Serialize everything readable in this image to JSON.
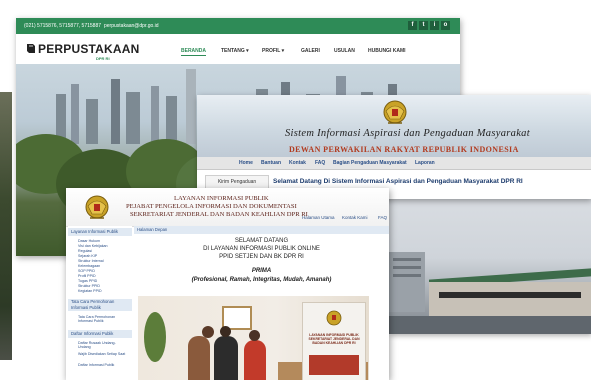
{
  "library": {
    "phone": "(021) 5715876, 5715877, 5715887",
    "email": "perpustakaan@dpr.go.id",
    "logo": "PERPUSTAKAAN",
    "logo_sub": "DPR RI",
    "nav": [
      "BERANDA",
      "TENTANG ▾",
      "PROFIL ▾",
      "GALERI",
      "USULAN",
      "HUBUNGI KAMI"
    ],
    "social": [
      "f",
      "t",
      "i",
      "o"
    ]
  },
  "aspirasi": {
    "title": "Sistem Informasi Aspirasi dan Pengaduan Masyarakat",
    "org": "DEWAN PERWAKILAN RAKYAT REPUBLIK INDONESIA",
    "nav": [
      "Home",
      "Bantuan",
      "Kontak",
      "FAQ",
      "Bagian Pengaduan Masyarakat",
      "Laporan"
    ],
    "tab": "Kirim Pengaduan",
    "welcome": "Selamat Datang Di Sistem Informasi Aspirasi dan Pengaduan Masyarakat DPR RI"
  },
  "ppid": {
    "header_l1": "LAYANAN INFORMASI PUBLIK",
    "header_l2": "PEJABAT PENGELOLA INFORMASI DAN DOKUMENTASI",
    "header_l3": "SEKRETARIAT JENDERAL DAN BADAN KEAHLIAN DPR RI",
    "links": [
      "Halaman Utama",
      "Kontak Kami",
      "FAQ"
    ],
    "sidebar": {
      "section1": "Layanan Informasi Publik",
      "items1": [
        "Dasar Hukum",
        "Visi dan Kebijakan",
        "Regulasi",
        "Sejarah KIP",
        "Struktur Internal",
        "Kelembagaan",
        "SOP PPID",
        "Profil PPID",
        "Tugas PPID",
        "Struktur PPID",
        "Kegiatan PPID"
      ],
      "section2": "Tata Cara Permohonan Informasi Publik",
      "items2": [
        "Tata Cara Permohonan Informasi Publik"
      ],
      "section3": "Daftar Informasi Publik",
      "items3": [
        "Daftar Rusaak Undang-Undang",
        "Wajib Disediakan Setiap Saat",
        "Daftar Informasi Publik"
      ]
    },
    "main_tab": "Halaman Depan",
    "welcome1": "SELAMAT DATANG",
    "welcome2": "DI LAYANAN INFORMASI PUBLIK ONLINE",
    "welcome3": "PPID SETJEN DAN BK DPR RI",
    "prima": "PRIMA",
    "prima_desc": "(Profesional, Ramah, Integritas, Mudah, Amanah)",
    "banner": "LAYANAN INFORMASI PUBLIK SEKRETARIAT JENDERAL DAN BADAN KEAHLIAN DPR RI"
  },
  "colors": {
    "green": "#2e8b57",
    "navy": "#1e3d6e",
    "maroon": "#b23a1e"
  }
}
